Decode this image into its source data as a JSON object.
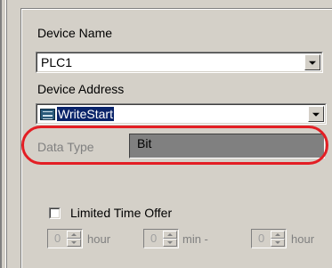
{
  "device_name": {
    "label": "Device Name",
    "value": "PLC1"
  },
  "device_address": {
    "label": "Device Address",
    "value": "WriteStart",
    "icon": "device-address-icon"
  },
  "data_type": {
    "label": "Data Type",
    "value": "Bit",
    "highlight_color": "#e31e24"
  },
  "limited_time_offer": {
    "label": "Limited Time Offer",
    "checked": false
  },
  "timers": [
    {
      "value": "0",
      "unit": "hour"
    },
    {
      "value": "0",
      "unit": "min -"
    },
    {
      "value": "0",
      "unit": "hour"
    }
  ],
  "colors": {
    "panel": "#d4d0c8",
    "selection": "#0a246a",
    "readonly_field": "#808080"
  }
}
